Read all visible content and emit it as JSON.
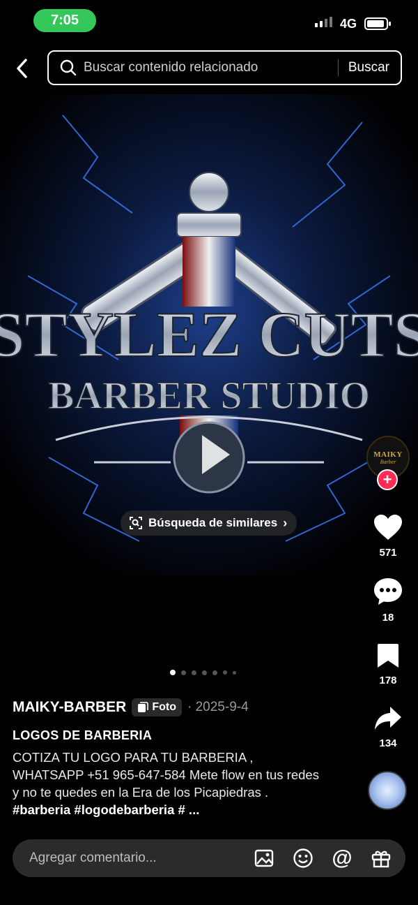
{
  "status_bar": {
    "time": "7:05",
    "network": "4G",
    "time_pill_color": "#34c759"
  },
  "header": {
    "back_icon": "chevron-left-icon",
    "search_placeholder": "Buscar contenido relacionado",
    "search_button": "Buscar"
  },
  "media": {
    "logo_line1": "STYLEZ CUTS",
    "logo_line2": "BARBER STUDIO",
    "similar_search_label": "Búsqueda de similares",
    "carousel_count": 7,
    "carousel_active_index": 0
  },
  "sidebar": {
    "avatar_text": "MAIKY",
    "avatar_subtext": "Barber",
    "likes": "571",
    "comments": "18",
    "saves": "178",
    "shares": "134"
  },
  "post": {
    "author": "MAIKY-BARBER",
    "type_badge": "Foto",
    "date": "· 2025-9-4",
    "title": "LOGOS DE BARBERIA",
    "description": "COTIZA TU   LOGO PARA TU BARBERIA , WHATSAPP +51 965-647-584 Mete flow en tus redes y no te quedes en la Era de los Picapiedras . ",
    "hashtags": "#barberia #logodebarberia # ...",
    "accent_color": "#fe2c55"
  },
  "comment_bar": {
    "placeholder": "Agregar comentario...",
    "icons": [
      "image-icon",
      "emoji-icon",
      "mention-icon",
      "gift-icon"
    ]
  }
}
